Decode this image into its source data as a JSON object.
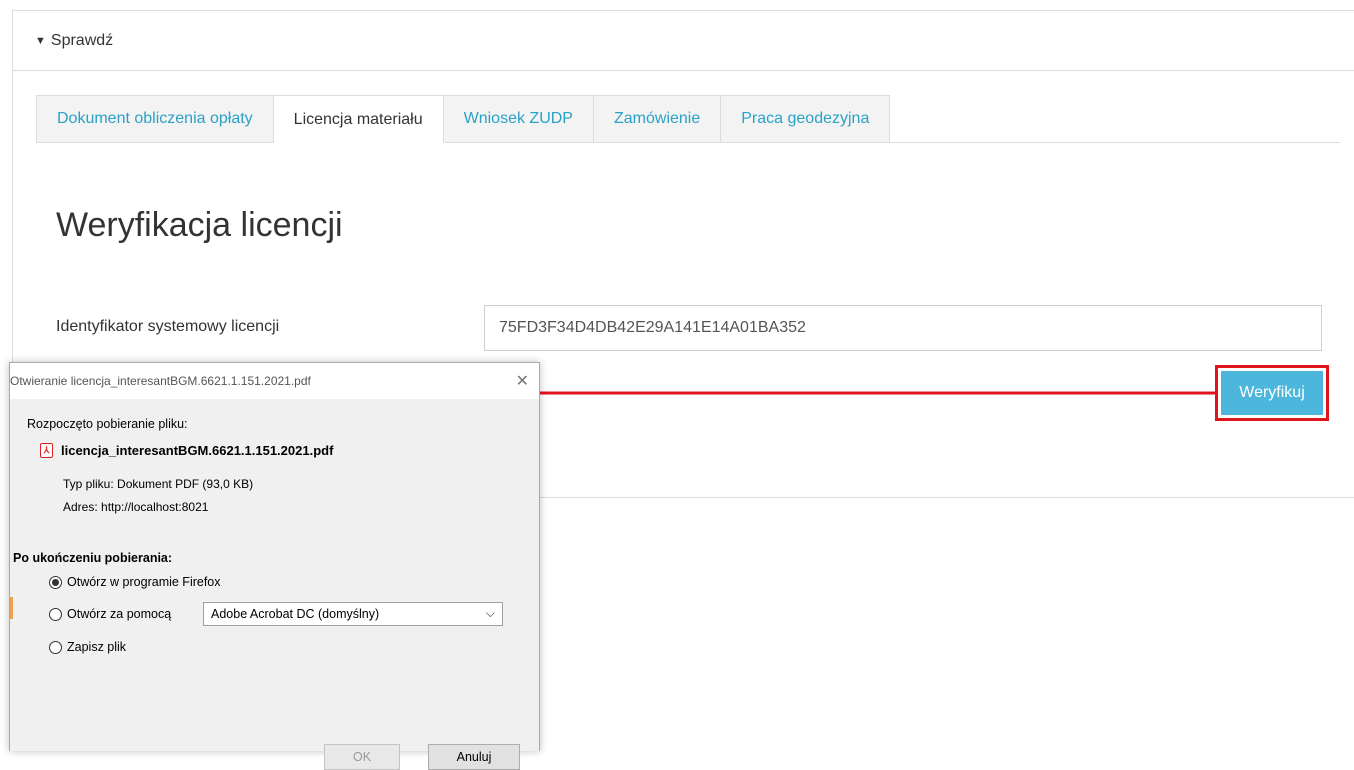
{
  "section": {
    "toggle_label": "Sprawdź"
  },
  "tabs": [
    {
      "label": "Dokument obliczenia opłaty",
      "active": false
    },
    {
      "label": "Licencja materiału",
      "active": true
    },
    {
      "label": "Wniosek ZUDP",
      "active": false
    },
    {
      "label": "Zamówienie",
      "active": false
    },
    {
      "label": "Praca geodezyjna",
      "active": false
    }
  ],
  "page": {
    "heading": "Weryfikacja licencji",
    "field_label": "Identyfikator systemowy licencji",
    "field_value": "75FD3F34D4DB42E29A141E14A01BA352",
    "verify_button": "Weryfikuj"
  },
  "annotation": {
    "highlight_color": "#e0141d"
  },
  "dialog": {
    "title": "Otwieranie licencja_interesantBGM.6621.1.151.2021.pdf",
    "close_symbol": "✕",
    "download_started": "Rozpoczęto pobieranie pliku:",
    "filename": "licencja_interesantBGM.6621.1.151.2021.pdf",
    "file_type_label": "Typ pliku:",
    "file_type_value": "Dokument PDF (93,0 KB)",
    "address_label": "Adres:",
    "address_value": "http://localhost:8021",
    "after_download_label": "Po ukończeniu pobierania:",
    "option_open_firefox": "Otwórz w programie Firefox",
    "option_open_with": "Otwórz za pomocą",
    "option_save": "Zapisz plik",
    "selected_option": "open_firefox",
    "app_select_value": "Adobe Acrobat DC (domyślny)",
    "ok_button": "OK",
    "cancel_button": "Anuluj"
  }
}
